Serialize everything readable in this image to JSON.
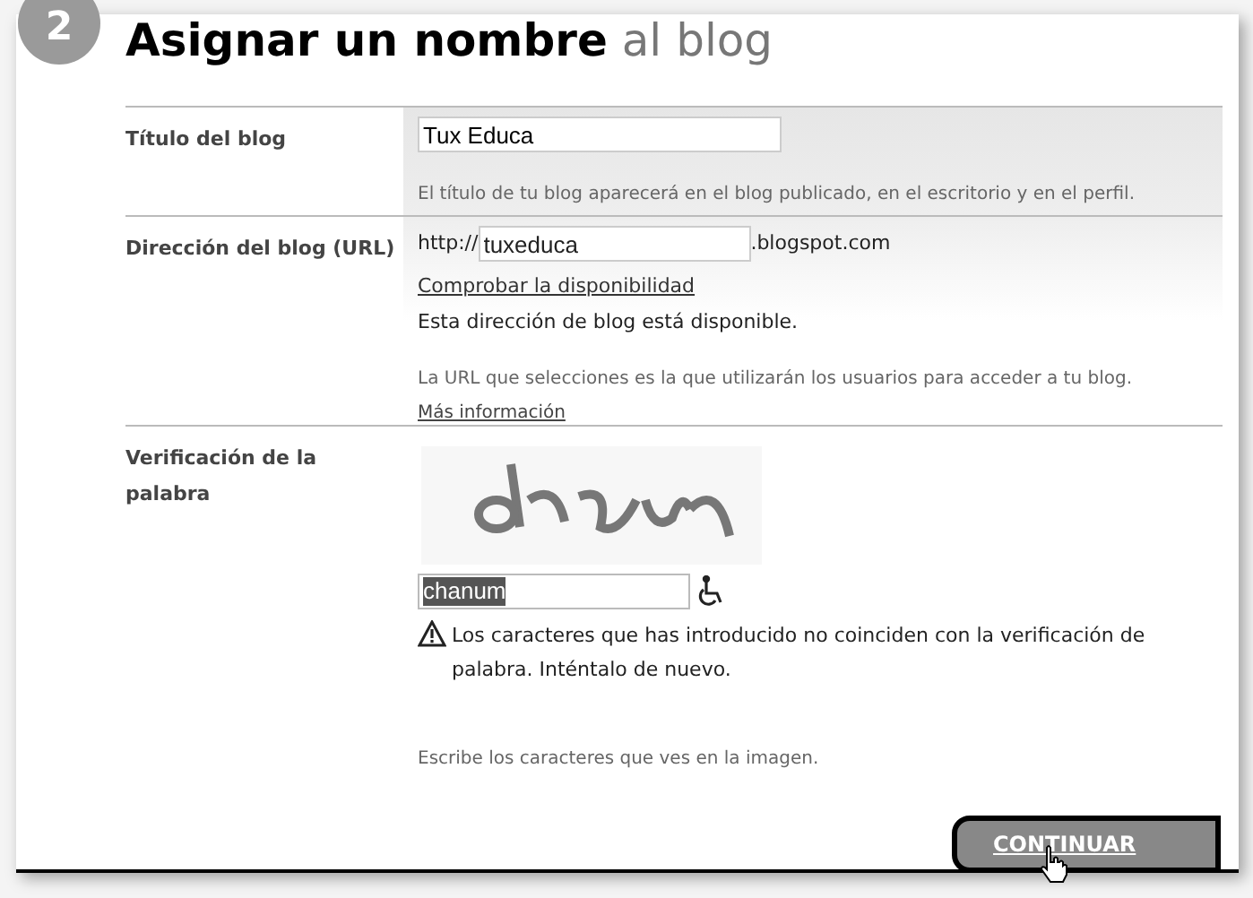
{
  "step": {
    "number": "2",
    "title_bold": "Asignar un nombre",
    "title_rest": "al blog"
  },
  "title_row": {
    "label": "Título del blog",
    "value": "Tux Educa",
    "hint": "El título de tu blog aparecerá en el blog publicado, en el escritorio y en el perfil."
  },
  "url_row": {
    "label": "Dirección del blog (URL)",
    "prefix": "http://",
    "value": "tuxeduca",
    "suffix": ".blogspot.com",
    "check_link": "Comprobar la disponibilidad",
    "status": "Esta dirección de blog está disponible.",
    "hint": "La URL que selecciones es la que utilizarán los usuarios para acceder a tu blog.",
    "more_link": "Más información"
  },
  "captcha_row": {
    "label": "Verificación de la palabra",
    "value": "chanum",
    "value_selected": true,
    "error": "Los caracteres que has introducido no coinciden con la verificación de palabra. Inténtalo de nuevo.",
    "hint": "Escribe los caracteres que ves en la imagen."
  },
  "continue_button": {
    "label": "CONTINUAR"
  }
}
